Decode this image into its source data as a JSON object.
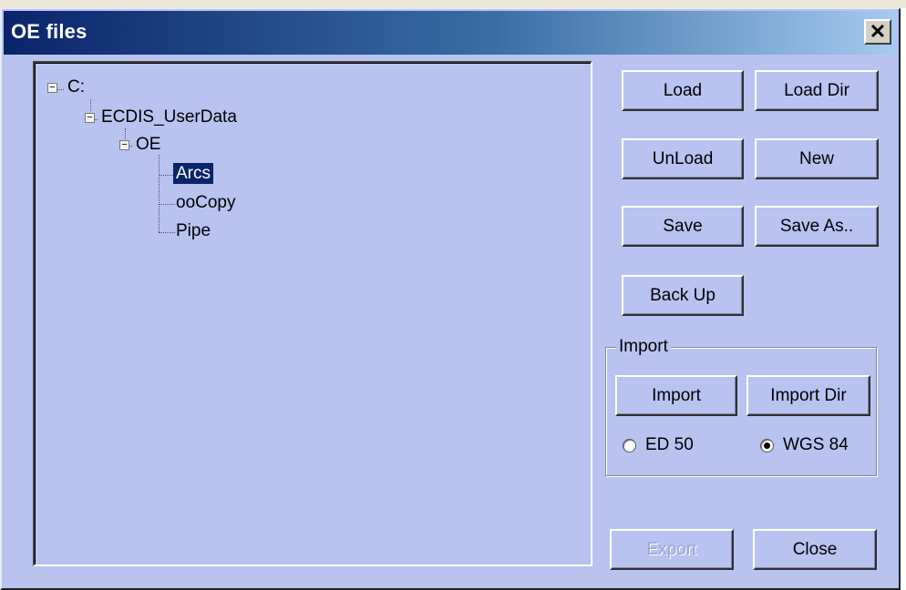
{
  "window": {
    "title": "OE files",
    "close_glyph": "✕"
  },
  "tree": {
    "root": {
      "label": "C:",
      "expander": "−"
    },
    "folder": {
      "label": "ECDIS_UserData",
      "expander": "−"
    },
    "subfolder": {
      "label": "OE",
      "expander": "−"
    },
    "files": [
      {
        "label": "Arcs",
        "selected": true
      },
      {
        "label": "ooCopy",
        "selected": false
      },
      {
        "label": "Pipe",
        "selected": false
      }
    ]
  },
  "buttons": {
    "load": "Load",
    "load_dir": "Load Dir",
    "unload": "UnLoad",
    "new": "New",
    "save": "Save",
    "save_as": "Save As..",
    "back_up": "Back Up",
    "export": "Export",
    "close": "Close"
  },
  "import_group": {
    "label": "Import",
    "import": "Import",
    "import_dir": "Import Dir",
    "datum_options": [
      {
        "label": "ED 50",
        "checked": false
      },
      {
        "label": "WGS 84",
        "checked": true
      }
    ]
  },
  "colors": {
    "dialog_bg": "#b8c3f0",
    "titlebar_start": "#0a246a",
    "selection": "#0a246a"
  }
}
